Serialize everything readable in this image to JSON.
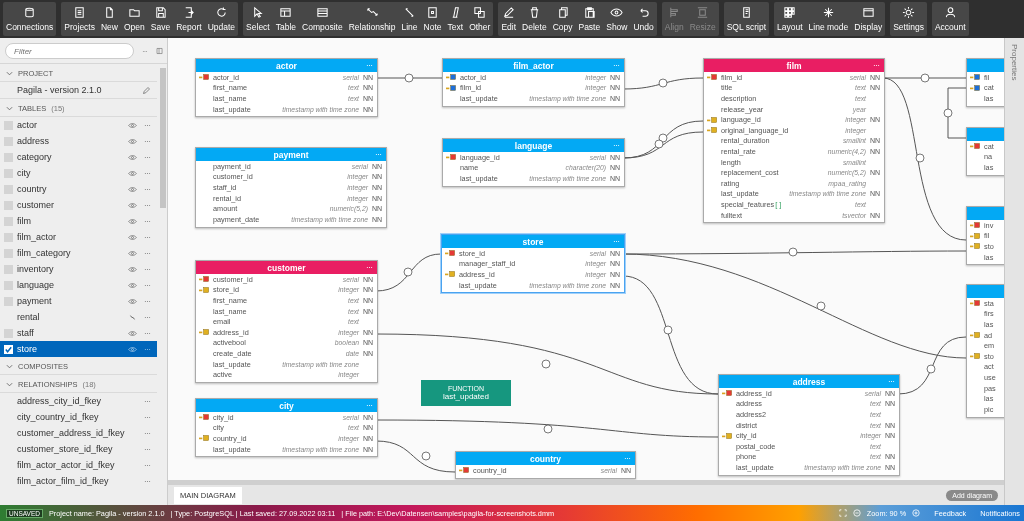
{
  "toolbar": {
    "groups": [
      {
        "buttons": [
          {
            "label": "Connections",
            "disabled": false
          }
        ]
      },
      {
        "buttons": [
          {
            "label": "Projects",
            "disabled": false
          },
          {
            "label": "New",
            "disabled": false
          },
          {
            "label": "Open",
            "disabled": false
          },
          {
            "label": "Save",
            "disabled": false
          },
          {
            "label": "Report",
            "disabled": false
          },
          {
            "label": "Update",
            "disabled": false
          }
        ]
      },
      {
        "buttons": [
          {
            "label": "Select",
            "disabled": false
          },
          {
            "label": "Table",
            "disabled": false
          },
          {
            "label": "Composite",
            "disabled": false
          },
          {
            "label": "Relationship",
            "disabled": false
          },
          {
            "label": "Line",
            "disabled": false
          },
          {
            "label": "Note",
            "disabled": false
          },
          {
            "label": "Text",
            "disabled": false
          },
          {
            "label": "Other",
            "disabled": false
          }
        ]
      },
      {
        "buttons": [
          {
            "label": "Edit",
            "disabled": false
          },
          {
            "label": "Delete",
            "disabled": false
          },
          {
            "label": "Copy",
            "disabled": false
          },
          {
            "label": "Paste",
            "disabled": false
          },
          {
            "label": "Show",
            "disabled": false
          },
          {
            "label": "Undo",
            "disabled": false
          }
        ]
      },
      {
        "buttons": [
          {
            "label": "Align",
            "disabled": true
          },
          {
            "label": "Resize",
            "disabled": true
          }
        ]
      },
      {
        "buttons": [
          {
            "label": "SQL script",
            "disabled": false
          }
        ]
      },
      {
        "buttons": [
          {
            "label": "Layout",
            "disabled": false
          },
          {
            "label": "Line mode",
            "disabled": false
          },
          {
            "label": "Display",
            "disabled": false
          }
        ]
      },
      {
        "buttons": [
          {
            "label": "Settings",
            "disabled": false
          }
        ]
      },
      {
        "buttons": [
          {
            "label": "Account",
            "disabled": false
          }
        ]
      }
    ]
  },
  "sidebar": {
    "filter": {
      "placeholder": "Filter"
    },
    "project": {
      "heading": "PROJECT",
      "name": "Pagila - version 2.1.0"
    },
    "tables": {
      "heading": "TABLES",
      "count": "(15)",
      "items": [
        {
          "name": "actor",
          "visible": true,
          "selected": false
        },
        {
          "name": "address",
          "visible": true,
          "selected": false
        },
        {
          "name": "category",
          "visible": true,
          "selected": false
        },
        {
          "name": "city",
          "visible": true,
          "selected": false
        },
        {
          "name": "country",
          "visible": true,
          "selected": false
        },
        {
          "name": "customer",
          "visible": true,
          "selected": false
        },
        {
          "name": "film",
          "visible": true,
          "selected": false
        },
        {
          "name": "film_actor",
          "visible": true,
          "selected": false
        },
        {
          "name": "film_category",
          "visible": true,
          "selected": false
        },
        {
          "name": "inventory",
          "visible": true,
          "selected": false
        },
        {
          "name": "language",
          "visible": true,
          "selected": false
        },
        {
          "name": "payment",
          "visible": true,
          "selected": false
        },
        {
          "name": "rental",
          "visible": false,
          "selected": false
        },
        {
          "name": "staff",
          "visible": true,
          "selected": false
        },
        {
          "name": "store",
          "visible": true,
          "selected": true
        }
      ]
    },
    "composites": {
      "heading": "COMPOSITES"
    },
    "relationships": {
      "heading": "RELATIONSHIPS",
      "count": "(18)",
      "items": [
        "address_city_id_fkey",
        "city_country_id_fkey",
        "customer_address_id_fkey",
        "customer_store_id_fkey",
        "film_actor_actor_id_fkey",
        "film_actor_film_id_fkey"
      ]
    }
  },
  "diagram": {
    "tables": [
      {
        "name": "actor",
        "color": "#03a9f4",
        "selected": false,
        "columns": [
          {
            "name": "actor_id",
            "type": "serial",
            "nn": "NN",
            "kind": "pk"
          },
          {
            "name": "first_name",
            "type": "text",
            "nn": "NN",
            "kind": "none"
          },
          {
            "name": "last_name",
            "type": "text",
            "nn": "NN",
            "kind": "none"
          },
          {
            "name": "last_update",
            "type": "timestamp with time zone",
            "nn": "NN",
            "kind": "none"
          }
        ]
      },
      {
        "name": "film_actor",
        "color": "#03a9f4",
        "selected": false,
        "columns": [
          {
            "name": "actor_id",
            "type": "integer",
            "nn": "NN",
            "kind": "pk_fk"
          },
          {
            "name": "film_id",
            "type": "integer",
            "nn": "NN",
            "kind": "pk_fk"
          },
          {
            "name": "last_update",
            "type": "timestamp with time zone",
            "nn": "NN",
            "kind": "none"
          }
        ]
      },
      {
        "name": "film",
        "color": "#e91e63",
        "selected": false,
        "columns": [
          {
            "name": "film_id",
            "type": "serial",
            "nn": "NN",
            "kind": "pk"
          },
          {
            "name": "title",
            "type": "text",
            "nn": "NN",
            "kind": "none"
          },
          {
            "name": "description",
            "type": "text",
            "kind": "none"
          },
          {
            "name": "release_year",
            "type": "year",
            "kind": "none"
          },
          {
            "name": "language_id",
            "type": "integer",
            "nn": "NN",
            "kind": "fk"
          },
          {
            "name": "original_language_id",
            "type": "integer",
            "kind": "fk"
          },
          {
            "name": "rental_duration",
            "type": "smallint",
            "nn": "NN",
            "kind": "none"
          },
          {
            "name": "rental_rate",
            "type": "numeric(4,2)",
            "nn": "NN",
            "kind": "none"
          },
          {
            "name": "length",
            "type": "smallint",
            "kind": "none"
          },
          {
            "name": "replacement_cost",
            "type": "numeric(5,2)",
            "nn": "NN",
            "kind": "none"
          },
          {
            "name": "rating",
            "type": "mpaa_rating",
            "kind": "none"
          },
          {
            "name": "last_update",
            "type": "timestamp with time zone",
            "nn": "NN",
            "kind": "none"
          },
          {
            "name": "special_features",
            "array": "[ ]",
            "type": "text",
            "kind": "none"
          },
          {
            "name": "fulltext",
            "type": "tsvector",
            "nn": "NN",
            "kind": "none"
          }
        ]
      },
      {
        "color": "#03a9f4",
        "selected": false,
        "columns": [
          {
            "name": "fil",
            "kind": "pk_fk"
          },
          {
            "name": "cat",
            "kind": "pk_fk"
          },
          {
            "name": "las",
            "kind": "none"
          }
        ]
      },
      {
        "color": "#03a9f4",
        "selected": false,
        "columns": [
          {
            "name": "cat",
            "kind": "pk"
          },
          {
            "name": "na",
            "kind": "none"
          },
          {
            "name": "las",
            "kind": "none"
          }
        ]
      },
      {
        "name": "language",
        "color": "#03a9f4",
        "selected": false,
        "columns": [
          {
            "name": "language_id",
            "type": "serial",
            "nn": "NN",
            "kind": "pk"
          },
          {
            "name": "name",
            "type": "character(20)",
            "nn": "NN",
            "kind": "none"
          },
          {
            "name": "last_update",
            "type": "timestamp with time zone",
            "nn": "NN",
            "kind": "none"
          }
        ]
      },
      {
        "name": "payment",
        "color": "#03a9f4",
        "selected": false,
        "columns": [
          {
            "name": "payment_id",
            "type": "serial",
            "nn": "NN",
            "kind": "none"
          },
          {
            "name": "customer_id",
            "type": "integer",
            "nn": "NN",
            "kind": "none"
          },
          {
            "name": "staff_id",
            "type": "integer",
            "nn": "NN",
            "kind": "none"
          },
          {
            "name": "rental_id",
            "type": "integer",
            "nn": "NN",
            "kind": "none"
          },
          {
            "name": "amount",
            "type": "numeric(5,2)",
            "nn": "NN",
            "kind": "none"
          },
          {
            "name": "payment_date",
            "type": "timestamp with time zone",
            "nn": "NN",
            "kind": "none"
          }
        ]
      },
      {
        "color": "#03a9f4",
        "selected": false,
        "columns": [
          {
            "name": "inv",
            "kind": "pk"
          },
          {
            "name": "fil",
            "kind": "fk"
          },
          {
            "name": "sto",
            "kind": "fk"
          },
          {
            "name": "las",
            "kind": "none"
          }
        ]
      },
      {
        "name": "store",
        "color": "#03a9f4",
        "selected": true,
        "columns": [
          {
            "name": "store_id",
            "type": "serial",
            "nn": "NN",
            "kind": "pk"
          },
          {
            "name": "manager_staff_id",
            "type": "integer",
            "nn": "NN",
            "kind": "none"
          },
          {
            "name": "address_id",
            "type": "integer",
            "nn": "NN",
            "kind": "fk"
          },
          {
            "name": "last_update",
            "type": "timestamp with time zone",
            "nn": "NN",
            "kind": "none"
          }
        ]
      },
      {
        "name": "customer",
        "color": "#e91e63",
        "selected": false,
        "columns": [
          {
            "name": "customer_id",
            "type": "serial",
            "nn": "NN",
            "kind": "pk"
          },
          {
            "name": "store_id",
            "type": "integer",
            "nn": "NN",
            "kind": "fk"
          },
          {
            "name": "first_name",
            "type": "text",
            "nn": "NN",
            "kind": "none"
          },
          {
            "name": "last_name",
            "type": "text",
            "nn": "NN",
            "kind": "none"
          },
          {
            "name": "email",
            "type": "text",
            "kind": "none"
          },
          {
            "name": "address_id",
            "type": "integer",
            "nn": "NN",
            "kind": "fk"
          },
          {
            "name": "activebool",
            "type": "boolean",
            "nn": "NN",
            "kind": "none"
          },
          {
            "name": "create_date",
            "type": "date",
            "nn": "NN",
            "kind": "none"
          },
          {
            "name": "last_update",
            "type": "timestamp with time zone",
            "kind": "none"
          },
          {
            "name": "active",
            "type": "integer",
            "kind": "none"
          }
        ]
      },
      {
        "color": "#03a9f4",
        "selected": false,
        "columns": [
          {
            "name": "sta",
            "kind": "pk"
          },
          {
            "name": "firs",
            "kind": "none"
          },
          {
            "name": "las",
            "kind": "none"
          },
          {
            "name": "ad",
            "kind": "fk"
          },
          {
            "name": "em",
            "kind": "none"
          },
          {
            "name": "sto",
            "kind": "fk"
          },
          {
            "name": "act",
            "kind": "none"
          },
          {
            "name": "use",
            "kind": "none"
          },
          {
            "name": "pas",
            "kind": "none"
          },
          {
            "name": "las",
            "kind": "none"
          },
          {
            "name": "pic",
            "kind": "none"
          }
        ]
      },
      {
        "name": "city",
        "color": "#03a9f4",
        "selected": false,
        "columns": [
          {
            "name": "city_id",
            "type": "serial",
            "nn": "NN",
            "kind": "pk"
          },
          {
            "name": "city",
            "type": "text",
            "nn": "NN",
            "kind": "none"
          },
          {
            "name": "country_id",
            "type": "integer",
            "nn": "NN",
            "kind": "fk"
          },
          {
            "name": "last_update",
            "type": "timestamp with time zone",
            "nn": "NN",
            "kind": "none"
          }
        ]
      },
      {
        "name": "country",
        "color": "#03a9f4",
        "selected": false,
        "columns": [
          {
            "name": "country_id",
            "type": "serial",
            "nn": "NN",
            "kind": "pk"
          }
        ]
      },
      {
        "name": "address",
        "color": "#03a9f4",
        "selected": false,
        "columns": [
          {
            "name": "address_id",
            "type": "serial",
            "nn": "NN",
            "kind": "pk"
          },
          {
            "name": "address",
            "type": "text",
            "nn": "NN",
            "kind": "none"
          },
          {
            "name": "address2",
            "type": "text",
            "kind": "none"
          },
          {
            "name": "district",
            "type": "text",
            "nn": "NN",
            "kind": "none"
          },
          {
            "name": "city_id",
            "type": "integer",
            "nn": "NN",
            "kind": "fk"
          },
          {
            "name": "postal_code",
            "type": "text",
            "kind": "none"
          },
          {
            "name": "phone",
            "type": "text",
            "nn": "NN",
            "kind": "none"
          },
          {
            "name": "last_update",
            "type": "timestamp with time zone",
            "nn": "NN",
            "kind": "none"
          }
        ]
      }
    ],
    "function": {
      "label": "FUNCTION",
      "name": "last_updated"
    }
  },
  "properties_panel": {
    "title": "Properties"
  },
  "diagram_tabs": [
    {
      "label": "MAIN DIAGRAM",
      "selected": true
    }
  ],
  "add_diagram": "Add diagram",
  "status_bar": {
    "state": "UNSAVED",
    "project": "Project name: Pagila - version 2.1.0",
    "type": "| Type: PostgreSQL | Last saved: 27.09.2022 03:11",
    "path": "| File path: E:\\Dev\\Datensen\\samples\\pagila-for-screenshots.dmm",
    "zoom": "Zoom: 90 %",
    "feedback": "Feedback",
    "notifications": "Notifications"
  }
}
